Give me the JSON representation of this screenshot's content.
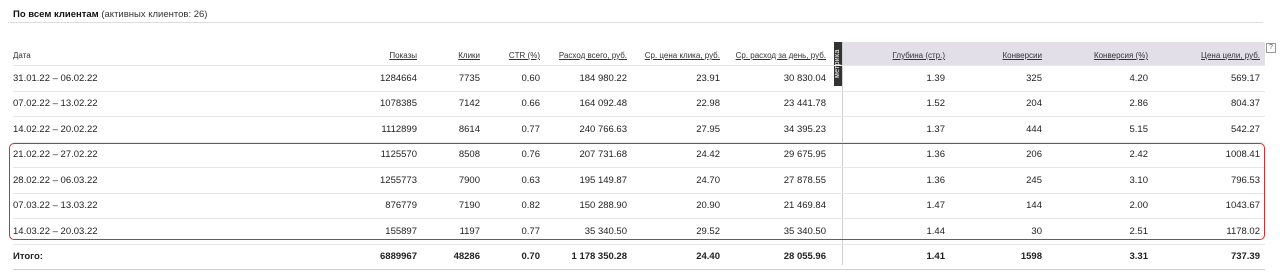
{
  "header": {
    "title": "По всем клиентам",
    "subtitle": "(активных клиентов: 26)"
  },
  "metrika_label": "метрика",
  "help_label": "?",
  "columns": [
    "Дата",
    "Показы",
    "Клики",
    "CTR (%)",
    "Расход всего, руб.",
    "Ср. цена клика, руб.",
    "Ср. расход за день, руб.",
    "Глубина (стр.)",
    "Конверсии",
    "Конверсия (%)",
    "Цена цели, руб."
  ],
  "rows": [
    [
      "31.01.22 – 06.02.22",
      "1284664",
      "7735",
      "0.60",
      "184 980.22",
      "23.91",
      "30 830.04",
      "1.39",
      "325",
      "4.20",
      "569.17"
    ],
    [
      "07.02.22 – 13.02.22",
      "1078385",
      "7142",
      "0.66",
      "164 092.48",
      "22.98",
      "23 441.78",
      "1.52",
      "204",
      "2.86",
      "804.37"
    ],
    [
      "14.02.22 – 20.02.22",
      "1112899",
      "8614",
      "0.77",
      "240 766.63",
      "27.95",
      "34 395.23",
      "1.37",
      "444",
      "5.15",
      "542.27"
    ],
    [
      "21.02.22 – 27.02.22",
      "1125570",
      "8508",
      "0.76",
      "207 731.68",
      "24.42",
      "29 675.95",
      "1.36",
      "206",
      "2.42",
      "1008.41"
    ],
    [
      "28.02.22 – 06.03.22",
      "1255773",
      "7900",
      "0.63",
      "195 149.87",
      "24.70",
      "27 878.55",
      "1.36",
      "245",
      "3.10",
      "796.53"
    ],
    [
      "07.03.22 – 13.03.22",
      "876779",
      "7190",
      "0.82",
      "150 288.90",
      "20.90",
      "21 469.84",
      "1.47",
      "144",
      "2.00",
      "1043.67"
    ],
    [
      "14.03.22 – 20.03.22",
      "155897",
      "1197",
      "0.77",
      "35 340.50",
      "29.52",
      "35 340.50",
      "1.44",
      "30",
      "2.51",
      "1178.02"
    ]
  ],
  "total": [
    "Итого:",
    "6889967",
    "48286",
    "0.70",
    "1 178 350.28",
    "24.40",
    "28 055.96",
    "1.41",
    "1598",
    "3.31",
    "737.39"
  ],
  "colors": {
    "highlight": "#e0292e",
    "metrika_band": "#e3dfe9"
  }
}
